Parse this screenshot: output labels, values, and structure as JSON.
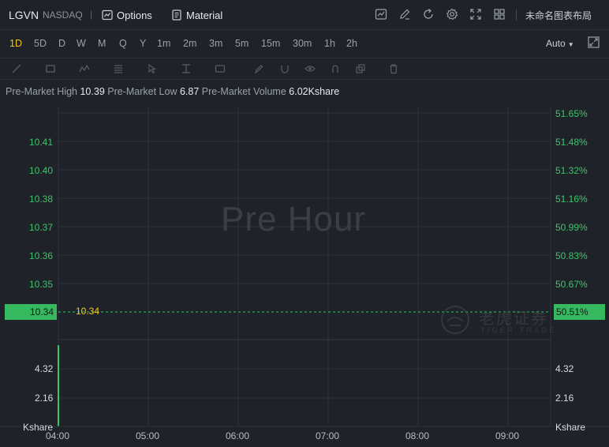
{
  "header": {
    "symbol": "LGVN",
    "exchange": "NASDAQ",
    "separator": "|",
    "options_label": "Options",
    "material_label": "Material",
    "layout_name": "未命名图表布局"
  },
  "timeframes": [
    "1D",
    "5D",
    "D",
    "W",
    "M",
    "Q",
    "Y",
    "1m",
    "2m",
    "3m",
    "5m",
    "15m",
    "30m",
    "1h",
    "2h"
  ],
  "active_timeframe": "1D",
  "scale_mode": "Auto",
  "stats": {
    "high_label": "Pre-Market High",
    "high_value": "10.39",
    "low_label": "Pre-Market Low",
    "low_value": "6.87",
    "volume_label": "Pre-Market Volume",
    "volume_value": "6.02Kshare"
  },
  "chart": {
    "watermark": "Pre Hour",
    "left_axis": [
      "10.41",
      "10.40",
      "10.38",
      "10.37",
      "10.36",
      "10.35"
    ],
    "right_axis": [
      "51.65%",
      "51.48%",
      "51.32%",
      "51.16%",
      "50.99%",
      "50.83%",
      "50.67%"
    ],
    "current_price": "10.34",
    "current_pct": "50.51%",
    "volume_axis_left": [
      "4.32",
      "2.16",
      "Kshare"
    ],
    "volume_axis_right": [
      "4.32",
      "2.16",
      "Kshare"
    ],
    "time_axis": [
      "04:00",
      "05:00",
      "06:00",
      "07:00",
      "08:00",
      "09:00"
    ],
    "logo_cn": "老虎证券",
    "logo_en": "TIGER TRADE",
    "up_color": "#3fc26a",
    "accent_color": "#f5c518"
  }
}
